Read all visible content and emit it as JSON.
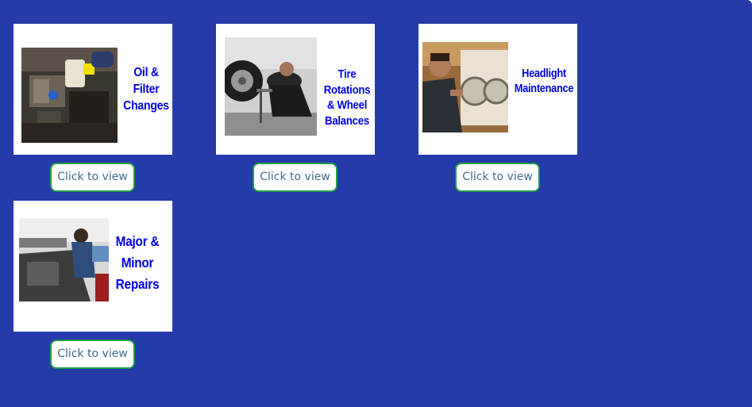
{
  "colors": {
    "background": "#253ba9",
    "caption_text": "#0000e6",
    "button_border": "#1e9e4a",
    "button_text": "#3f6d8f"
  },
  "services": [
    {
      "caption_lines": [
        "Oil &",
        "Filter",
        "Changes"
      ],
      "photo": "engine-oil-photo",
      "button_label": "Click to view"
    },
    {
      "caption_lines": [
        "Tire",
        "Rotations",
        "& Wheel",
        "Balances"
      ],
      "photo": "mechanic-wheel-photo",
      "button_label": "Click to view"
    },
    {
      "caption_lines": [
        "Headlight",
        "Maintenance"
      ],
      "photo": "headlight-technician-photo",
      "button_label": "Click to view"
    },
    {
      "caption_lines": [
        "Major &",
        "Minor",
        "Repairs"
      ],
      "photo": "engine-repair-photo",
      "button_label": "Click to view"
    }
  ]
}
